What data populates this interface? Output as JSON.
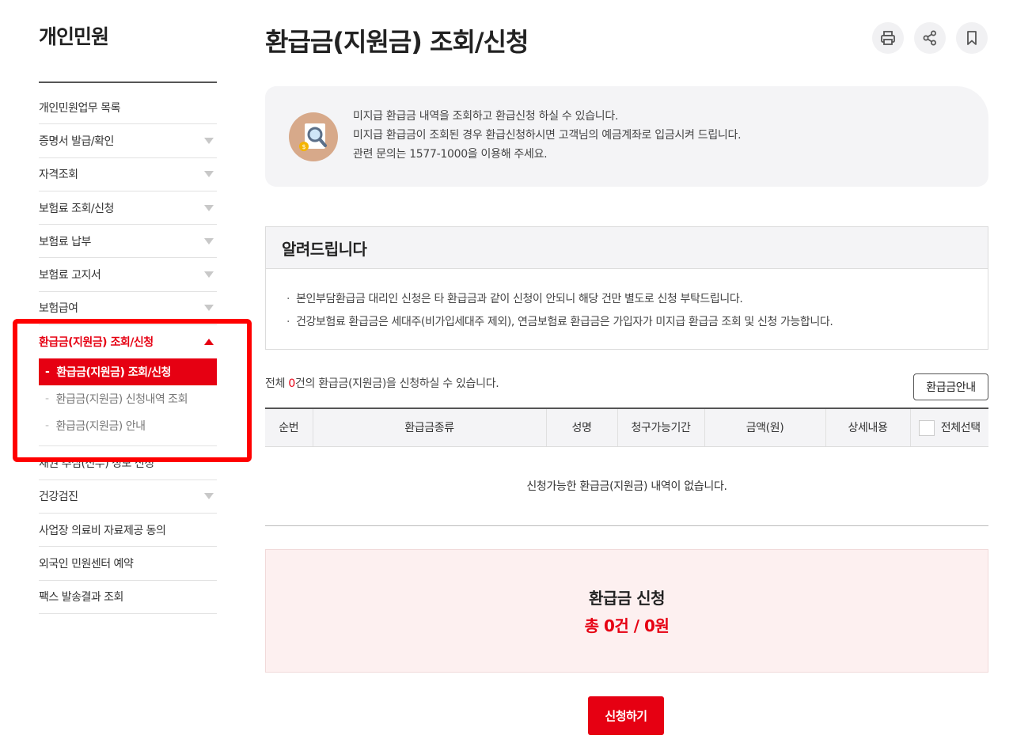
{
  "sidebar": {
    "title": "개인민원",
    "items": [
      {
        "label": "개인민원업무 목록",
        "has_arrow": false
      },
      {
        "label": "증명서 발급/확인",
        "has_arrow": true
      },
      {
        "label": "자격조회",
        "has_arrow": true
      },
      {
        "label": "보험료 조회/신청",
        "has_arrow": true
      },
      {
        "label": "보험료 납부",
        "has_arrow": true
      },
      {
        "label": "보험료 고지서",
        "has_arrow": true
      },
      {
        "label": "보험급여",
        "has_arrow": true
      },
      {
        "label": "환급금(지원금) 조회/신청",
        "has_arrow": true,
        "expanded": true
      }
    ],
    "subitems": [
      {
        "label": "환급금(지원금) 조회/신청",
        "active": true
      },
      {
        "label": "환급금(지원금) 신청내역 조회",
        "active": false
      },
      {
        "label": "환급금(지원금) 안내",
        "active": false
      }
    ],
    "items_after": [
      {
        "label": "채권 추심(전부) 정보 신청",
        "has_arrow": false
      },
      {
        "label": "건강검진",
        "has_arrow": true
      },
      {
        "label": "사업장 의료비 자료제공 동의",
        "has_arrow": false
      },
      {
        "label": "외국인 민원센터 예약",
        "has_arrow": false
      },
      {
        "label": "팩스 발송결과 조회",
        "has_arrow": false
      }
    ]
  },
  "page": {
    "title": "환급금(지원금) 조회/신청",
    "tools": [
      "print-icon",
      "share-icon",
      "bookmark-icon"
    ]
  },
  "info": {
    "line1": "미지급 환급금 내역을 조회하고 환급신청 하실 수 있습니다.",
    "line2": "미지급 환급금이 조회된 경우 환급신청하시면 고객님의 예금계좌로 입금시켜 드립니다.",
    "line3": "관련 문의는 1577-1000을 이용해 주세요."
  },
  "notice": {
    "title": "알려드립니다",
    "items": [
      "본인부담환급금 대리인 신청은 타 환급금과 같이 신청이 안되니 해당 건만 별도로 신청 부탁드립니다.",
      "건강보험료 환급금은 세대주(비가입세대주 제외), 연금보험료 환급금은 가입자가 미지급 환급금 조회 및 신청 가능합니다."
    ]
  },
  "count": {
    "prefix": "전체 ",
    "number": "0",
    "suffix": "건의 환급금(지원금)을 신청하실 수 있습니다."
  },
  "guide_button": "환급금안내",
  "table": {
    "headers": [
      "순번",
      "환급금종류",
      "성명",
      "청구가능기간",
      "금액(원)",
      "상세내용",
      "전체선택"
    ],
    "empty_message": "신청가능한 환급금(지원금) 내역이 없습니다."
  },
  "summary": {
    "title": "환급금 신청",
    "total": "총 0건 / 0원"
  },
  "apply_button": "신청하기",
  "colors": {
    "accent": "#e60012",
    "highlight_box": "#ff0000"
  }
}
